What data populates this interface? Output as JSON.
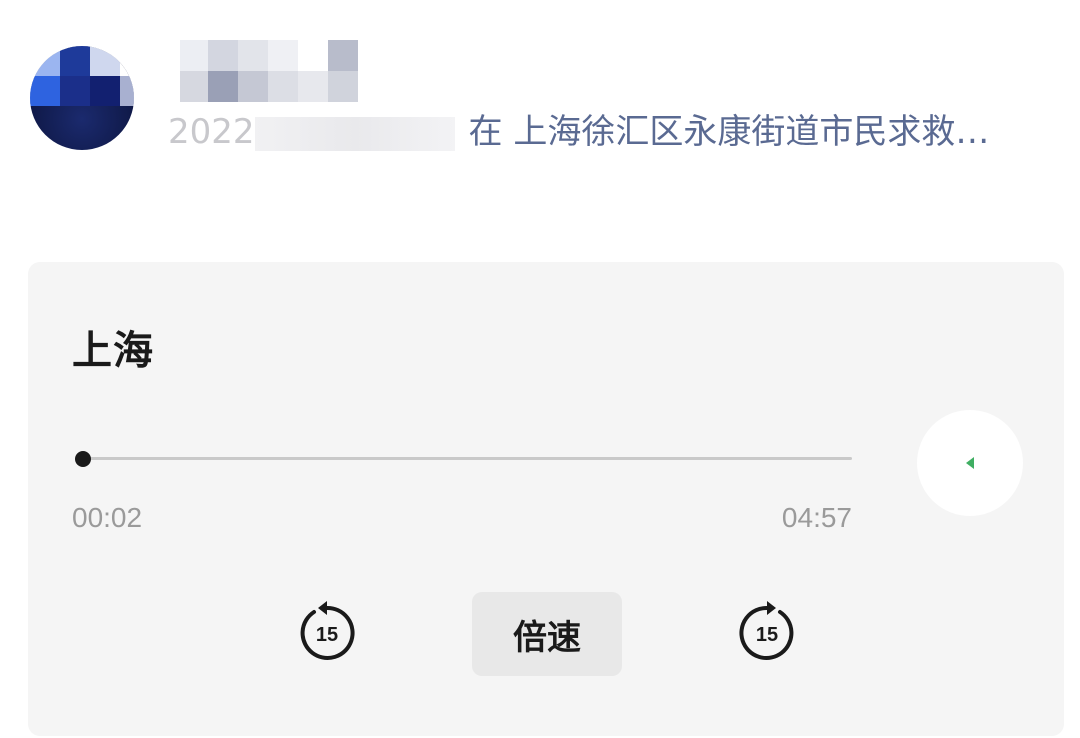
{
  "post": {
    "date_text": "2022",
    "location_text": "在 上海徐汇区永康街道市民求救…"
  },
  "player": {
    "title": "上海",
    "current_time": "00:02",
    "total_time": "04:57",
    "progress_fraction": 0.007,
    "skip_back_seconds": "15",
    "skip_forward_seconds": "15",
    "speed_label": "倍速",
    "accent_color": "#3fae62"
  },
  "icons": {
    "play": "play-icon",
    "skip_back": "replay-15-icon",
    "skip_forward": "forward-15-icon"
  }
}
